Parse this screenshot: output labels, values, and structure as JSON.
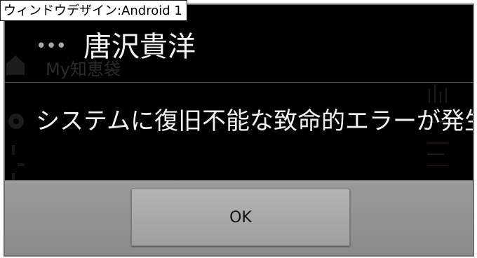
{
  "window": {
    "label": "ウィンドウデザイン:Android 1"
  },
  "background_app": {
    "title": "My知恵袋"
  },
  "dialog": {
    "overflow_icon": "more-dots-icon",
    "title": "唐沢貴洋",
    "message": "システムに復旧不能な致命的エラーが発生",
    "ok_label": "OK"
  },
  "colors": {
    "dialog_background": "#000000",
    "dialog_text": "#f2f2f2",
    "button_bar": "#8e8e8e",
    "button": "#a8a8a8",
    "frame_border": "#6e6e6e"
  }
}
